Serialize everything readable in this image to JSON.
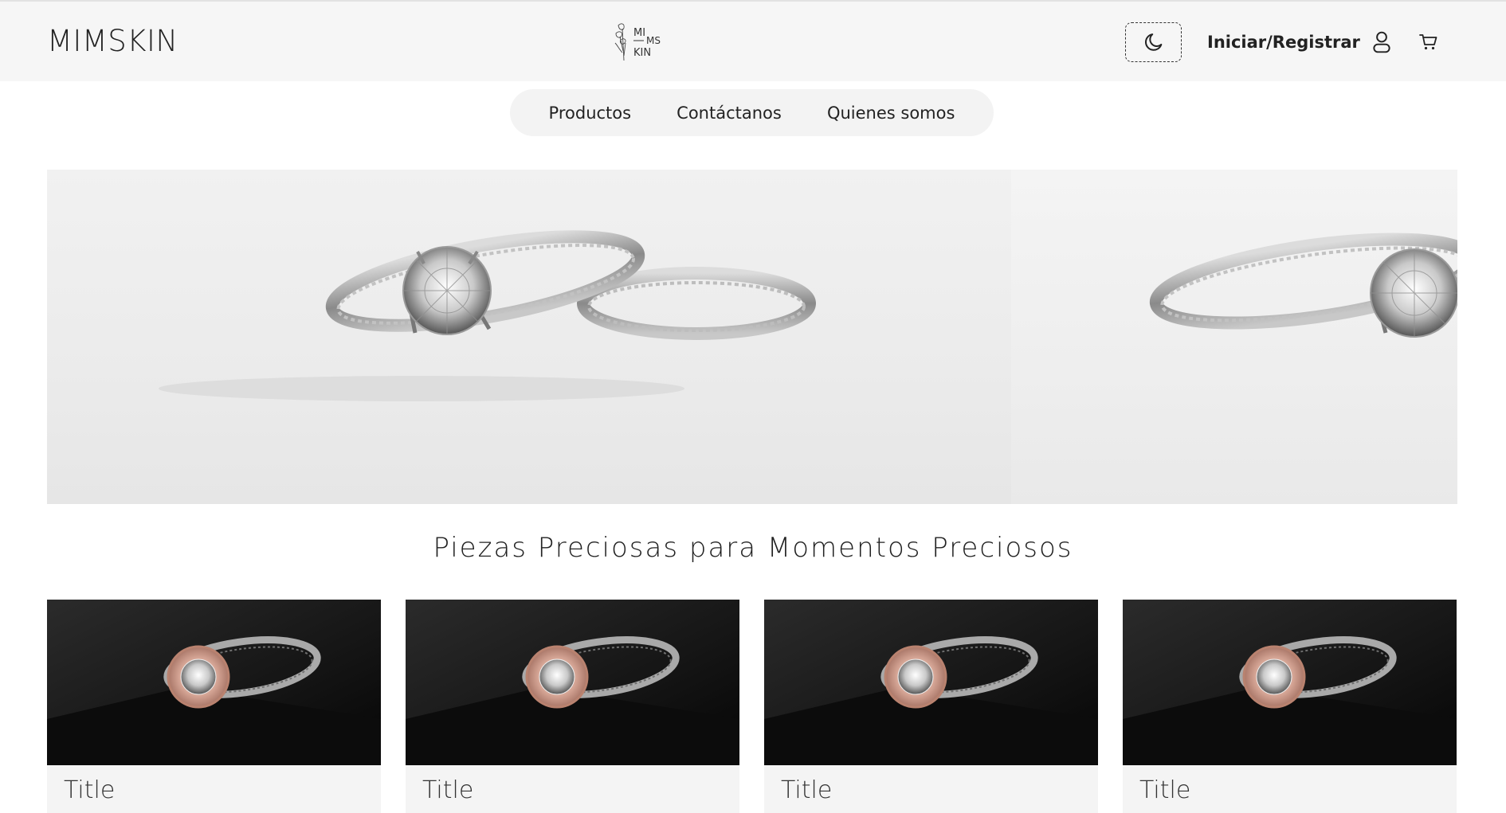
{
  "header": {
    "brand": "MIMSKIN",
    "logo_text_top": "MI",
    "logo_text_mid": "MS",
    "logo_text_bottom": "KIN",
    "login_label": "Iniciar/Registrar",
    "icons": [
      "moon-icon",
      "user-icon",
      "cart-icon"
    ]
  },
  "nav": {
    "items": [
      {
        "label": "Productos"
      },
      {
        "label": "Contáctanos"
      },
      {
        "label": "Quienes somos"
      }
    ]
  },
  "hero": {
    "images": [
      "engagement-ring-and-band",
      "engagement-ring-and-band"
    ]
  },
  "section": {
    "title": "Piezas Preciosas para Momentos Preciosos"
  },
  "products": [
    {
      "title": "Title",
      "image": "rose-gold-halo-ring"
    },
    {
      "title": "Title",
      "image": "rose-gold-halo-ring"
    },
    {
      "title": "Title",
      "image": "rose-gold-halo-ring"
    },
    {
      "title": "Title",
      "image": "rose-gold-halo-ring"
    }
  ],
  "colors": {
    "header_bg": "#f6f6f6",
    "nav_bg": "#f3f3f3",
    "card_bg": "#f4f4f4",
    "text": "#222222"
  }
}
